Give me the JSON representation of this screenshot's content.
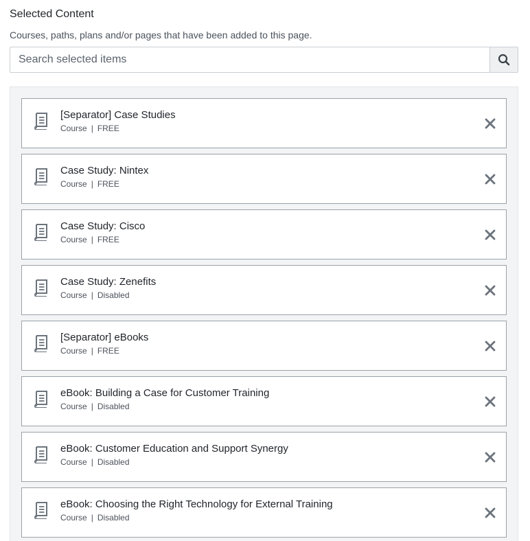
{
  "header": {
    "title": "Selected Content",
    "subtitle": "Courses, paths, plans and/or pages that have been added to this page."
  },
  "search": {
    "placeholder": "Search selected items",
    "button_icon": "search-icon"
  },
  "items": [
    {
      "name": "[Separator] Case Studies",
      "type": "Course",
      "status": "FREE"
    },
    {
      "name": "Case Study: Nintex",
      "type": "Course",
      "status": "FREE"
    },
    {
      "name": "Case Study: Cisco",
      "type": "Course",
      "status": "FREE"
    },
    {
      "name": "Case Study: Zenefits",
      "type": "Course",
      "status": "Disabled"
    },
    {
      "name": "[Separator] eBooks",
      "type": "Course",
      "status": "FREE"
    },
    {
      "name": "eBook: Building a Case for Customer Training",
      "type": "Course",
      "status": "Disabled"
    },
    {
      "name": "eBook: Customer Education and Support Synergy",
      "type": "Course",
      "status": "Disabled"
    },
    {
      "name": "eBook: Choosing the Right Technology for External Training",
      "type": "Course",
      "status": "Disabled"
    }
  ],
  "meta_separator": "|",
  "icons": {
    "item": "book-icon",
    "remove": "close-icon"
  },
  "colors": {
    "icon": "#6b737c",
    "border": "#9aa1a8",
    "panel_bg": "#f3f4f5"
  }
}
